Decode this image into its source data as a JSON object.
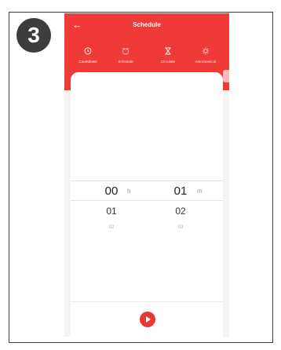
{
  "step": "3",
  "header": {
    "title": "Schedule",
    "back_icon": "arrow-left-icon",
    "color": "#ef3a38"
  },
  "tabs": [
    {
      "label": "Countdown",
      "icon": "clock-icon",
      "active": true
    },
    {
      "label": "Schedule",
      "icon": "alarm-clock-icon",
      "active": false
    },
    {
      "label": "Circulate",
      "icon": "hourglass-icon",
      "active": false
    },
    {
      "label": "Astronomical",
      "icon": "sun-icon",
      "active": false
    }
  ],
  "picker": {
    "hours": {
      "selected": "00",
      "next": "01",
      "after": "02",
      "unit": "h"
    },
    "minutes": {
      "selected": "01",
      "next": "02",
      "after": "03",
      "unit": "m"
    }
  },
  "play_button": {
    "icon": "play-icon",
    "color": "#e53935"
  }
}
